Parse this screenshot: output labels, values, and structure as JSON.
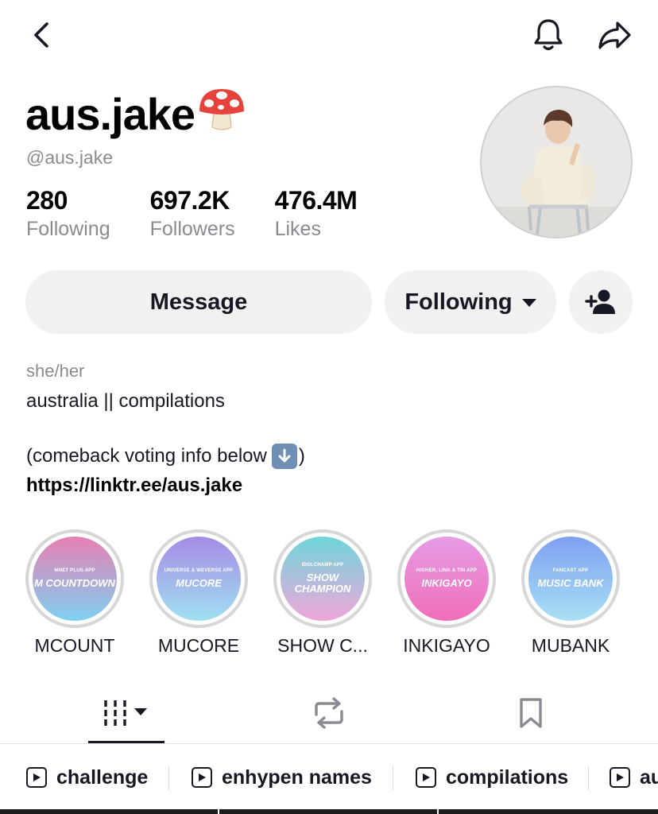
{
  "profile": {
    "display_name": "aus.jake",
    "username": "@aus.jake"
  },
  "stats": [
    {
      "value": "280",
      "label": "Following"
    },
    {
      "value": "697.2K",
      "label": "Followers"
    },
    {
      "value": "476.4M",
      "label": "Likes"
    }
  ],
  "actions": {
    "message_label": "Message",
    "following_label": "Following"
  },
  "bio": {
    "pronouns": "she/her",
    "line1": "australia || compilations",
    "line2_prefix": "(comeback voting info below",
    "line2_suffix": ")",
    "link": "https://linktr.ee/aus.jake"
  },
  "highlights": [
    {
      "label": "MCOUNT",
      "subtitle": "MNET PLUS APP",
      "logo": "M COUNTDOWN",
      "color_top": "#e77fb2",
      "color_bottom": "#7fd0f0"
    },
    {
      "label": "MUCORE",
      "subtitle": "UNIVERSE & WEVERSE APP",
      "logo": "MUCORE",
      "color_top": "#a68be6",
      "color_bottom": "#9fe0f0"
    },
    {
      "label": "SHOW C...",
      "subtitle": "IDOLCHAMP APP",
      "logo": "SHOW CHAMPION",
      "color_top": "#6fd6d9",
      "color_bottom": "#f0a6da"
    },
    {
      "label": "INKIGAYO",
      "subtitle": "HIGHER, LINK & TIN APP",
      "logo": "INKIGAYO",
      "color_top": "#e79be6",
      "color_bottom": "#f06fb8"
    },
    {
      "label": "MUBANK",
      "subtitle": "FANCAST APP",
      "logo": "MUSIC BANK",
      "color_top": "#7ea0f0",
      "color_bottom": "#a8e0f5"
    }
  ],
  "tabs": [
    {
      "icon": "grid-icon",
      "active": true
    },
    {
      "icon": "repost-icon",
      "active": false
    },
    {
      "icon": "bookmark-icon",
      "active": false
    }
  ],
  "playlists": [
    {
      "label": "challenge"
    },
    {
      "label": "enhypen names"
    },
    {
      "label": "compilations"
    },
    {
      "label": "au"
    }
  ],
  "colors": {
    "text_primary": "#161823",
    "text_secondary": "#8a8b91",
    "button_bg": "#f1f1f2"
  }
}
